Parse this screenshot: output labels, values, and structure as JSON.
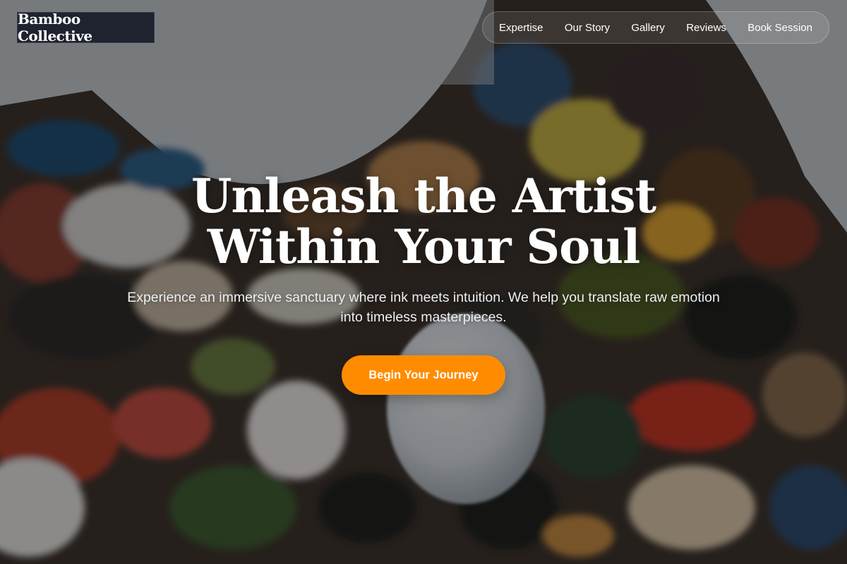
{
  "brand": {
    "name": "Bamboo Collective"
  },
  "nav": {
    "items": [
      {
        "label": "Expertise"
      },
      {
        "label": "Our Story"
      },
      {
        "label": "Gallery"
      },
      {
        "label": "Reviews"
      },
      {
        "label": "Book Session"
      }
    ]
  },
  "hero": {
    "headline_line1": "Unleash the Artist",
    "headline_line2": "Within Your Soul",
    "subtitle": "Experience an immersive sanctuary where ink meets intuition. We help you translate raw emotion into timeless masterpieces.",
    "cta_label": "Begin Your Journey"
  },
  "colors": {
    "accent": "#ff8c00",
    "brand_bg": "#1f2330",
    "text": "#ffffff"
  }
}
